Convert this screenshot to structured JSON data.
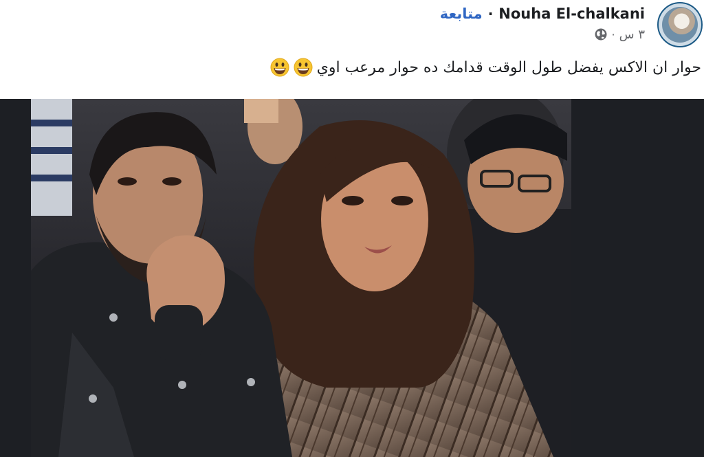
{
  "post": {
    "author_name": "Nouha El-chalkani",
    "follow_label": "متابعة",
    "separator": "·",
    "time_text": "٣ س",
    "privacy_icon": "globe-icon",
    "caption": "حوار ان الاكس يفضل طول الوقت قدامك ده حوار مرعب اوي",
    "caption_emojis": [
      "grinning-face-emoji",
      "grinning-face-emoji"
    ]
  },
  "colors": {
    "follow": "#2f66c3",
    "name": "#1c1e21",
    "meta": "#65676b",
    "photo_background": "#1d1f24"
  }
}
